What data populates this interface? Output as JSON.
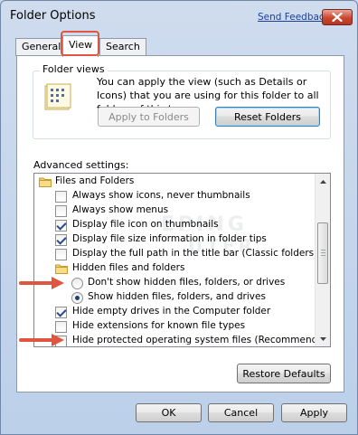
{
  "window": {
    "title": "Folder Options",
    "send_feedback": "Send Feedback"
  },
  "tabs": [
    {
      "label": "General"
    },
    {
      "label": "View"
    },
    {
      "label": "Search"
    }
  ],
  "folder_views": {
    "group_label": "Folder views",
    "description": "You can apply the view (such as Details or Icons) that you are using for this folder to all folders of this type.",
    "apply_button": "Apply to Folders",
    "reset_button": "Reset Folders"
  },
  "advanced": {
    "label": "Advanced settings:",
    "items": [
      {
        "type": "folder",
        "label": "Files and Folders"
      },
      {
        "type": "checkbox",
        "label": "Always show icons, never thumbnails",
        "checked": false
      },
      {
        "type": "checkbox",
        "label": "Always show menus",
        "checked": false
      },
      {
        "type": "checkbox",
        "label": "Display file icon on thumbnails",
        "checked": true
      },
      {
        "type": "checkbox",
        "label": "Display file size information in folder tips",
        "checked": true
      },
      {
        "type": "checkbox",
        "label": "Display the full path in the title bar (Classic folders only)",
        "checked": false
      },
      {
        "type": "folder",
        "label": "Hidden files and folders"
      },
      {
        "type": "radio",
        "label": "Don't show hidden files, folders, or drives",
        "checked": false
      },
      {
        "type": "radio",
        "label": "Show hidden files, folders, and drives",
        "checked": true
      },
      {
        "type": "checkbox",
        "label": "Hide empty drives in the Computer folder",
        "checked": true
      },
      {
        "type": "checkbox",
        "label": "Hide extensions for known file types",
        "checked": false
      },
      {
        "type": "checkbox",
        "label": "Hide protected operating system files (Recommended)",
        "checked": false
      }
    ],
    "restore_button": "Restore Defaults"
  },
  "footer": {
    "ok": "OK",
    "cancel": "Cancel",
    "apply": "Apply"
  },
  "watermark": {
    "line1": "EPING",
    "line2": "UTER"
  },
  "colors": {
    "highlight_red": "#e0553f",
    "link_blue": "#1b3f9a",
    "close_red": "#c9472f"
  }
}
